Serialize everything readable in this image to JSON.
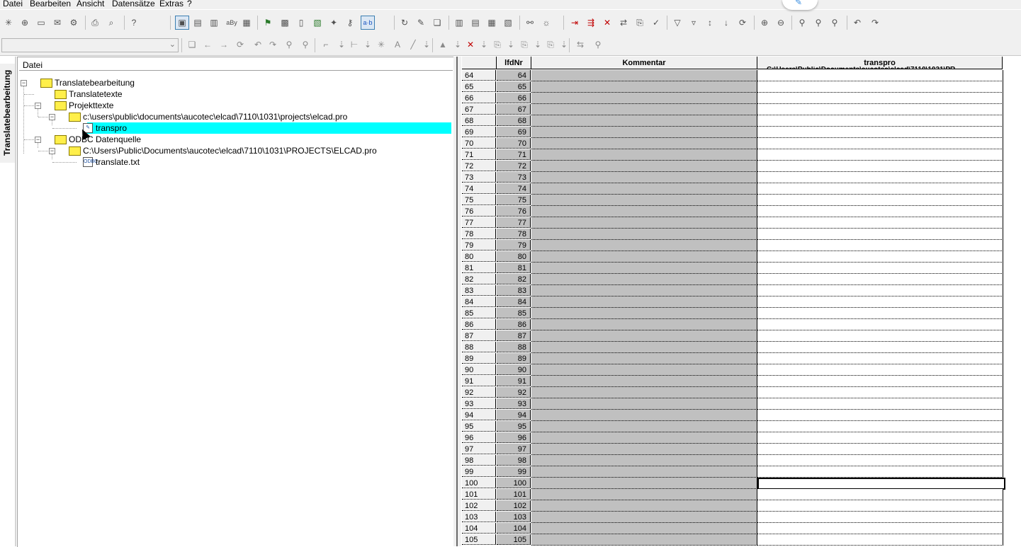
{
  "menu": [
    {
      "label": "Datei",
      "mnemonic": "D"
    },
    {
      "label": "Bearbeiten",
      "mnemonic": "B"
    },
    {
      "label": "Ansicht",
      "mnemonic": "A"
    },
    {
      "label": "Datensätze",
      "mnemonic": "s"
    },
    {
      "label": "Extras",
      "mnemonic": "E"
    },
    {
      "label": "?",
      "mnemonic": "?"
    }
  ],
  "side_tab": {
    "label": "Translatebearbeitung"
  },
  "tree": {
    "header": "Datei",
    "nodes": [
      {
        "label": "Translatebearbeitung",
        "icon": "folder-icon"
      },
      {
        "label": "Translatetexte",
        "icon": "folder-icon"
      },
      {
        "label": "Projekttexte",
        "icon": "folder-icon"
      },
      {
        "label": "c:\\users\\public\\documents\\aucotec\\elcad\\7110\\1031\\projects\\elcad.pro",
        "icon": "folder-icon"
      },
      {
        "label": "transpro",
        "icon": "edit-document-icon",
        "selected": true
      },
      {
        "label": "ODBC Datenquelle",
        "icon": "folder-icon"
      },
      {
        "label": "C:\\Users\\Public\\Documents\\aucotec\\elcad\\7110\\1031\\PROJECTS\\ELCAD.pro",
        "icon": "folder-icon"
      },
      {
        "label": "translate.txt",
        "icon": "odbc-file-icon"
      }
    ]
  },
  "grid": {
    "columns": [
      "",
      "lfdNr",
      "Kommentar",
      "transpro"
    ],
    "subheader_fragment": "C:\\Users\\Public\\Documents\\aucotec\\elcad\\7110\\1031\\PR",
    "rows": [
      {
        "rh": "64",
        "nr": "64"
      },
      {
        "rh": "65",
        "nr": "65"
      },
      {
        "rh": "66",
        "nr": "66"
      },
      {
        "rh": "67",
        "nr": "67"
      },
      {
        "rh": "68",
        "nr": "68"
      },
      {
        "rh": "69",
        "nr": "69"
      },
      {
        "rh": "70",
        "nr": "70"
      },
      {
        "rh": "71",
        "nr": "71"
      },
      {
        "rh": "72",
        "nr": "72"
      },
      {
        "rh": "73",
        "nr": "73"
      },
      {
        "rh": "74",
        "nr": "74"
      },
      {
        "rh": "75",
        "nr": "75"
      },
      {
        "rh": "76",
        "nr": "76"
      },
      {
        "rh": "77",
        "nr": "77"
      },
      {
        "rh": "78",
        "nr": "78"
      },
      {
        "rh": "79",
        "nr": "79"
      },
      {
        "rh": "80",
        "nr": "80"
      },
      {
        "rh": "81",
        "nr": "81"
      },
      {
        "rh": "82",
        "nr": "82"
      },
      {
        "rh": "83",
        "nr": "83"
      },
      {
        "rh": "84",
        "nr": "84"
      },
      {
        "rh": "85",
        "nr": "85"
      },
      {
        "rh": "86",
        "nr": "86"
      },
      {
        "rh": "87",
        "nr": "87"
      },
      {
        "rh": "88",
        "nr": "88"
      },
      {
        "rh": "89",
        "nr": "89"
      },
      {
        "rh": "90",
        "nr": "90"
      },
      {
        "rh": "91",
        "nr": "91"
      },
      {
        "rh": "92",
        "nr": "92"
      },
      {
        "rh": "93",
        "nr": "93"
      },
      {
        "rh": "94",
        "nr": "94"
      },
      {
        "rh": "95",
        "nr": "95"
      },
      {
        "rh": "96",
        "nr": "96"
      },
      {
        "rh": "97",
        "nr": "97"
      },
      {
        "rh": "98",
        "nr": "98"
      },
      {
        "rh": "99",
        "nr": "99"
      },
      {
        "rh": "100",
        "nr": "100",
        "active": true
      },
      {
        "rh": "101",
        "nr": "101"
      },
      {
        "rh": "102",
        "nr": "102"
      },
      {
        "rh": "103",
        "nr": "103"
      },
      {
        "rh": "104",
        "nr": "104"
      },
      {
        "rh": "105",
        "nr": "105"
      }
    ]
  },
  "toolbar1": {
    "icons": [
      "new-icon",
      "new-project-icon",
      "open-icon",
      "close-icon",
      "save-icon",
      "print-icon",
      "print-preview-icon",
      "help-icon",
      "view-tree-icon",
      "view-table-icon",
      "view-form-icon",
      "spellcheck-icon",
      "view-list-icon",
      "translate-icon",
      "grid-icon",
      "columns-icon",
      "database-icon",
      "filter-db-icon",
      "key-icon",
      "ab-icon",
      "refresh-icon",
      "edit-icon",
      "copy-icon",
      "table-a-icon",
      "table-b-icon",
      "table-c-icon",
      "table-d-icon",
      "link-icon",
      "sun-icon",
      "mark-next-icon",
      "mark-all-icon",
      "unmark-icon",
      "replace-icon",
      "paste-icon",
      "check-icon",
      "filter-icon",
      "filter-edit-icon",
      "sort-asc-icon",
      "sort-desc-icon",
      "refresh-sort-icon",
      "zoom-in-icon",
      "zoom-out-icon",
      "find-icon",
      "find-next-icon",
      "find-replace-icon",
      "undo-icon",
      "redo-icon"
    ],
    "pressed": [
      "view-tree-icon",
      "ab-icon"
    ],
    "ab_label": "a·b",
    "oby_label": "aBy"
  },
  "toolbar2": {
    "icons": [
      "copy-record-icon",
      "back-icon",
      "forward-icon",
      "refresh-record-icon",
      "undo2-icon",
      "redo2-icon",
      "glasses-icon",
      "glasses2-icon",
      "split-icon",
      "pin-icon",
      "merge-icon",
      "pin2-icon",
      "wildcard-icon",
      "font-icon",
      "draw-line-icon",
      "pin3-icon",
      "format-icon",
      "pin4-icon",
      "delete-icon",
      "pin5-icon",
      "copy-col-icon",
      "pin6-icon",
      "copy-col2-icon",
      "pin7-icon",
      "copy-col3-icon",
      "pin8-icon",
      "transfer-icon",
      "binoculars-icon"
    ]
  },
  "bubble_icon": "pen-icon"
}
